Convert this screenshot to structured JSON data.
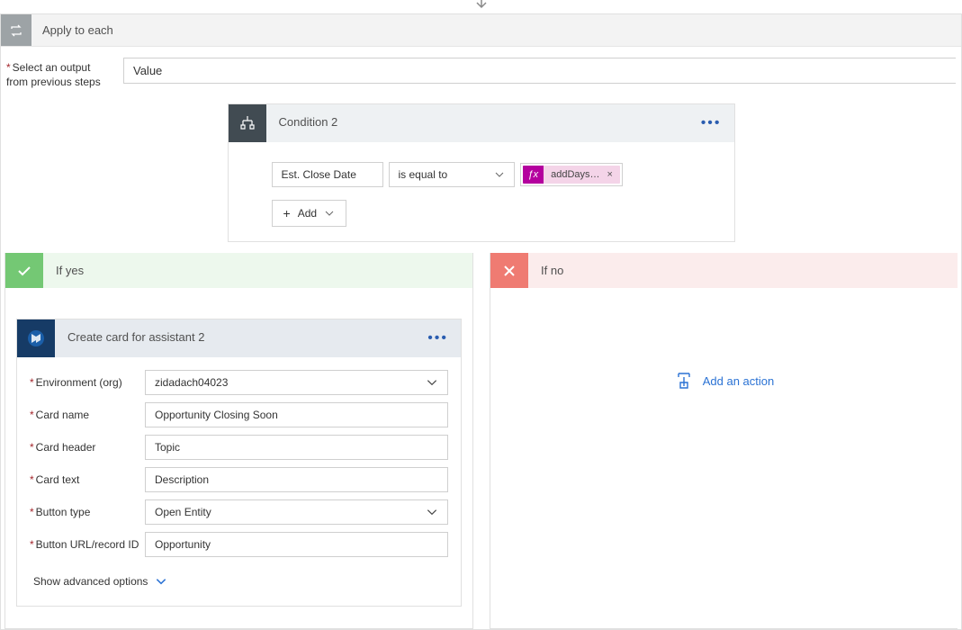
{
  "applyEach": {
    "title": "Apply to each",
    "selectLabelLine1": "Select an output",
    "selectLabelLine2": "from previous steps",
    "value": "Value"
  },
  "condition": {
    "title": "Condition 2",
    "field": "Est. Close Date",
    "operator": "is equal to",
    "exprLabel": "addDays…",
    "addLabel": "Add"
  },
  "branches": {
    "yesLabel": "If yes",
    "noLabel": "If no",
    "addActionLabel": "Add an action"
  },
  "actionCard": {
    "title": "Create card for assistant 2",
    "fields": {
      "environment": {
        "label": "Environment (org)",
        "value": "zidadach04023"
      },
      "cardName": {
        "label": "Card name",
        "value": "Opportunity Closing Soon"
      },
      "cardHeader": {
        "label": "Card header",
        "value": "Topic"
      },
      "cardText": {
        "label": "Card text",
        "value": "Description"
      },
      "buttonType": {
        "label": "Button type",
        "value": "Open Entity"
      },
      "buttonUrl": {
        "label": "Button URL/record ID",
        "value": "Opportunity"
      }
    },
    "showAdvanced": "Show advanced options"
  }
}
